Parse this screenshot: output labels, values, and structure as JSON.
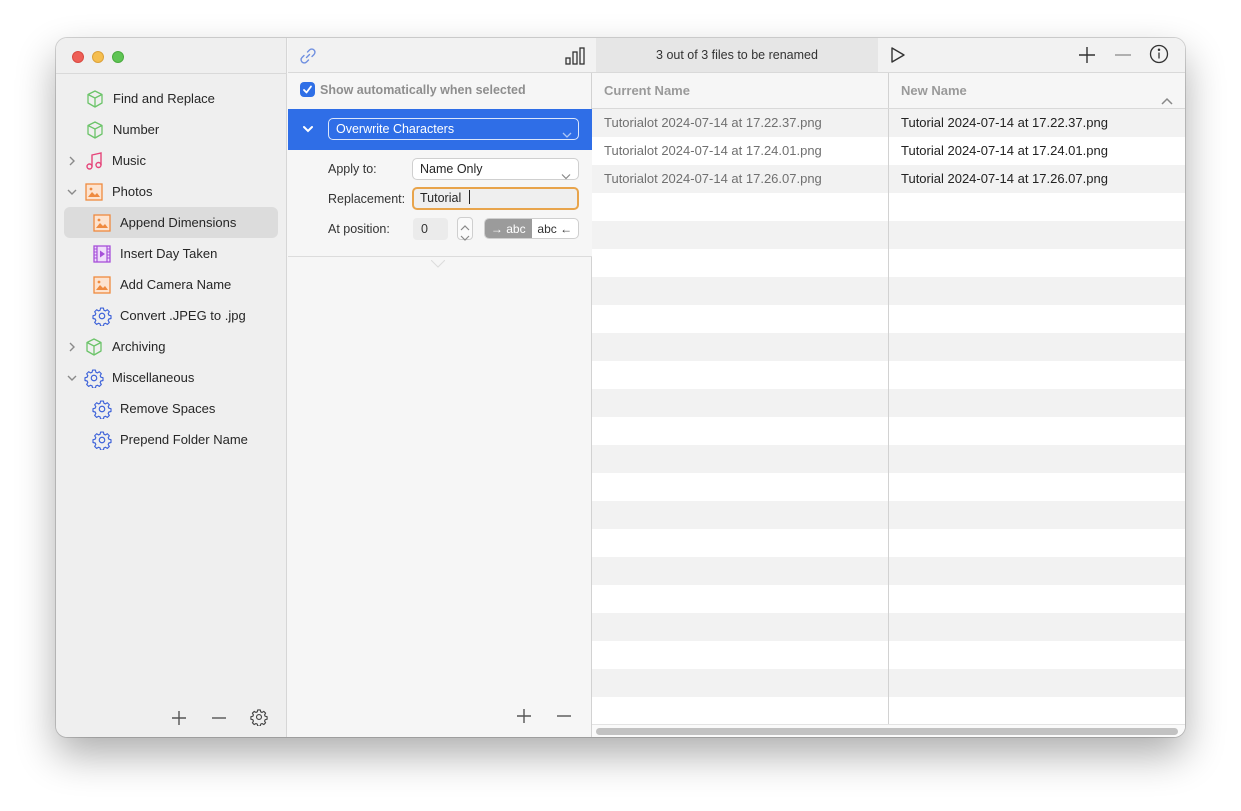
{
  "window": {
    "traffic_lights": [
      "close",
      "minimize",
      "zoom"
    ]
  },
  "sidebar": {
    "items": [
      {
        "label": "Find and Replace",
        "icon": "cube-icon",
        "level": 0,
        "disclosure": "none"
      },
      {
        "label": "Number",
        "icon": "cube-icon",
        "level": 0,
        "disclosure": "none"
      },
      {
        "label": "Music",
        "icon": "music-note-icon",
        "level": 0,
        "disclosure": "collapsed"
      },
      {
        "label": "Photos",
        "icon": "photo-icon",
        "level": 0,
        "disclosure": "expanded"
      },
      {
        "label": "Append Dimensions",
        "icon": "photo-icon",
        "level": 1,
        "selected": true
      },
      {
        "label": "Insert Day Taken",
        "icon": "film-icon",
        "level": 1
      },
      {
        "label": "Add Camera Name",
        "icon": "photo-icon",
        "level": 1
      },
      {
        "label": "Convert .JPEG to .jpg",
        "icon": "gear-icon",
        "level": 1
      },
      {
        "label": "Archiving",
        "icon": "cube-icon",
        "level": 0,
        "disclosure": "collapsed"
      },
      {
        "label": "Miscellaneous",
        "icon": "gear-icon",
        "level": 0,
        "disclosure": "expanded"
      },
      {
        "label": "Remove Spaces",
        "icon": "gear-icon",
        "level": 1
      },
      {
        "label": "Prepend Folder Name",
        "icon": "gear-icon",
        "level": 1
      }
    ],
    "footer": {
      "add": "+",
      "remove": "−",
      "settings": "gear"
    }
  },
  "middle": {
    "show_automatically": {
      "label": "Show automatically when selected",
      "checked": true
    },
    "rule": {
      "title": "Overwrite Characters",
      "apply_to_label": "Apply to:",
      "apply_to_value": "Name Only",
      "replacement_label": "Replacement:",
      "replacement_value": "Tutorial ",
      "position_label": "At position:",
      "position_value": "0",
      "direction_options": [
        "→ abc",
        "abc ←"
      ],
      "direction_selected": "→ abc"
    }
  },
  "right": {
    "status": "3 out of 3 files to be renamed",
    "columns": [
      "Current Name",
      "New Name"
    ],
    "rows": [
      {
        "current": "Tutorialot 2024-07-14 at 17.22.37.png",
        "new": "Tutorial 2024-07-14 at 17.22.37.png"
      },
      {
        "current": "Tutorialot 2024-07-14 at 17.24.01.png",
        "new": "Tutorial 2024-07-14 at 17.24.01.png"
      },
      {
        "current": "Tutorialot 2024-07-14 at 17.26.07.png",
        "new": "Tutorial 2024-07-14 at 17.26.07.png"
      }
    ]
  },
  "colors": {
    "accent": "#2f6ee7",
    "focus_ring": "#e8a44b",
    "cube": "#6cc46a",
    "music": "#e6457a",
    "photo": "#ef8a3f",
    "film": "#a64fd9",
    "gear": "#3e63d9"
  }
}
